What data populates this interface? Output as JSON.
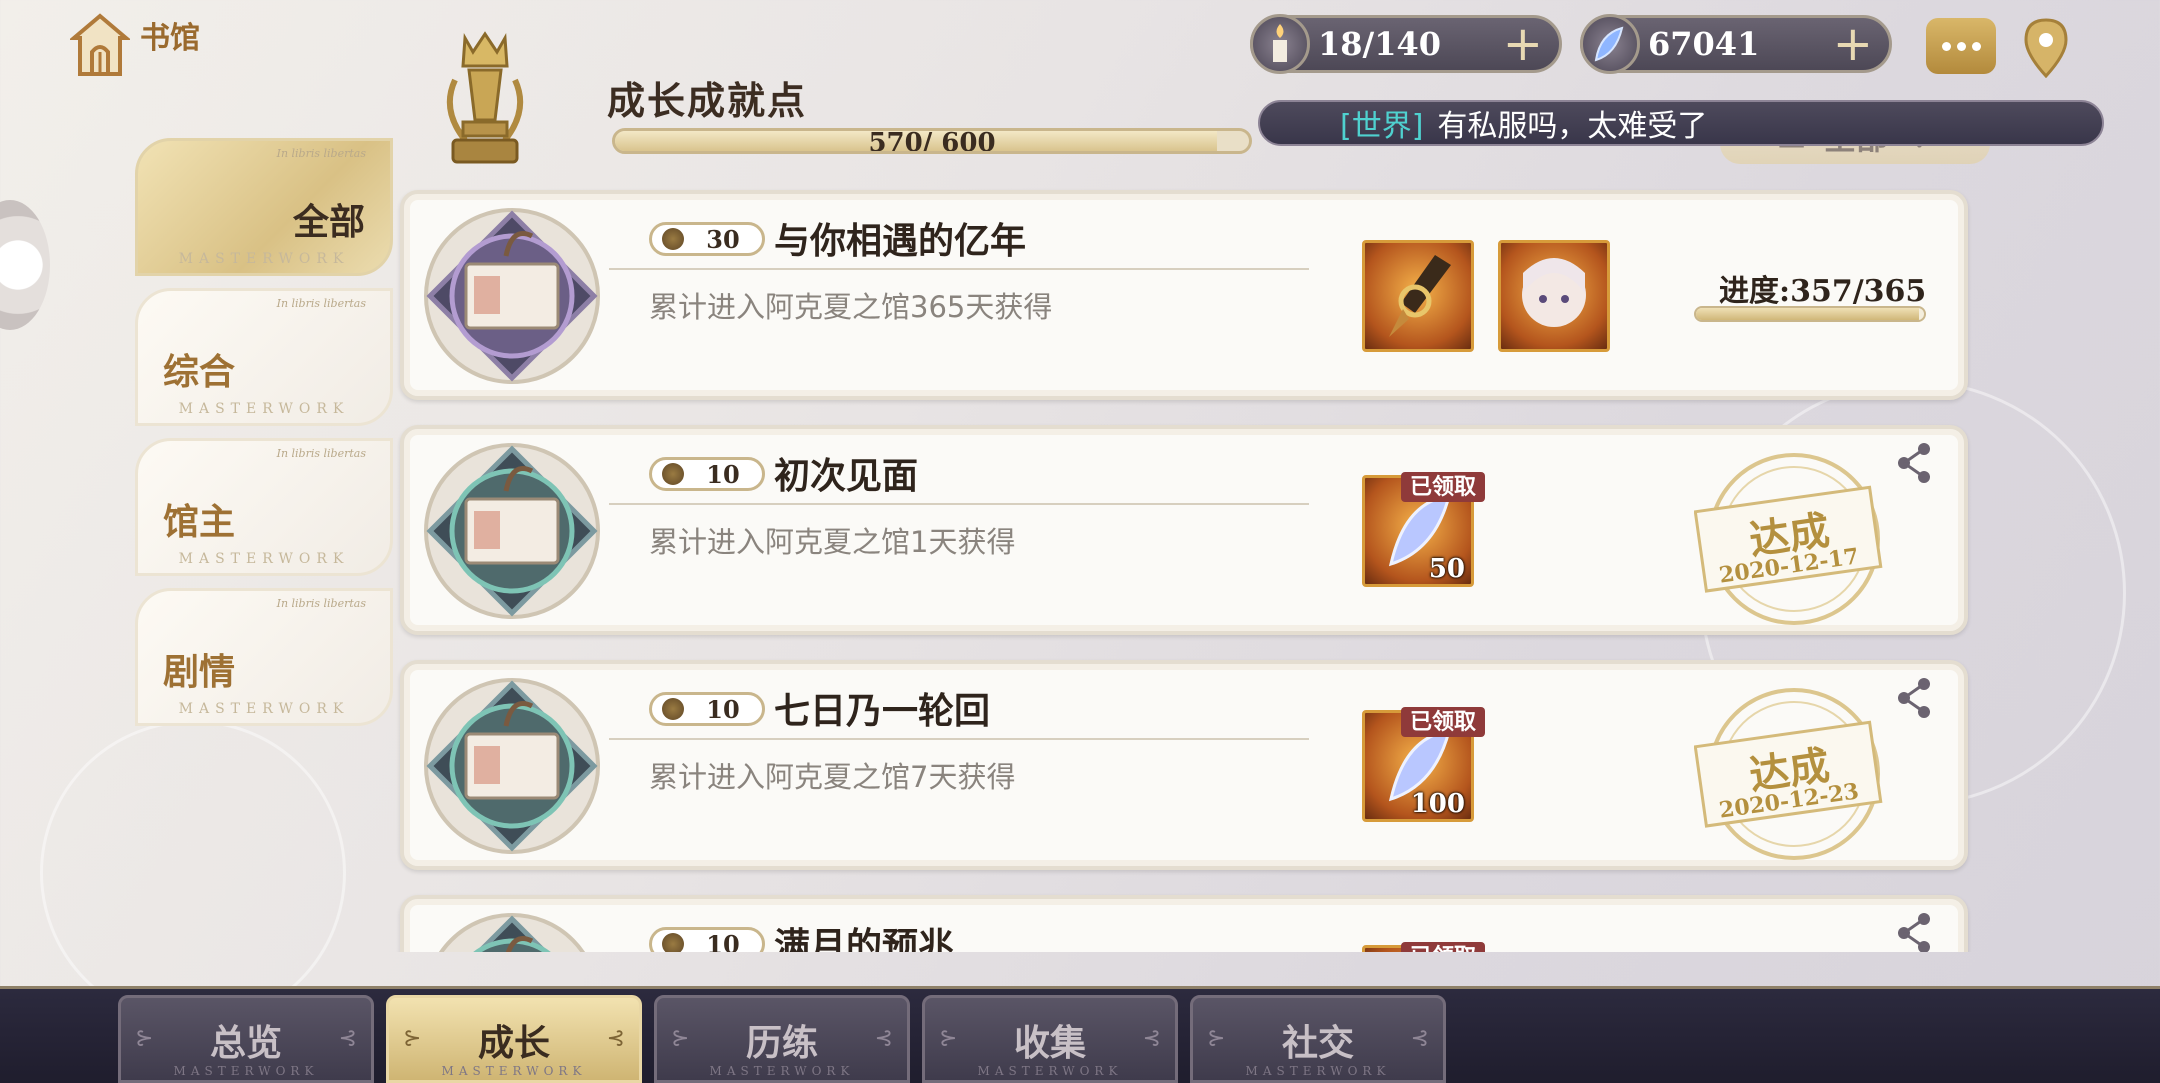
{
  "home": {
    "label": "书馆"
  },
  "header": {
    "title": "成长成就点",
    "progress_text": "570/ 600",
    "progress_fraction": 0.95
  },
  "currencies": [
    {
      "icon": "candle-icon",
      "value": "18/140"
    },
    {
      "icon": "feather-crystal-icon",
      "value": "67041"
    }
  ],
  "world_chat": {
    "channel": "[世界]",
    "message": "有私服吗，太难受了",
    "filter_label": "全部"
  },
  "side_tabs": [
    {
      "label": "全部",
      "top_text": "In libris libertas",
      "bottom_text": "MASTERWORK",
      "active": true
    },
    {
      "label": "综合",
      "top_text": "In libris libertas",
      "bottom_text": "MASTERWORK",
      "active": false
    },
    {
      "label": "馆主",
      "top_text": "In libris libertas",
      "bottom_text": "MASTERWORK",
      "active": false
    },
    {
      "label": "剧情",
      "top_text": "In libris libertas",
      "bottom_text": "MASTERWORK",
      "active": false
    }
  ],
  "achievements": [
    {
      "points": "30",
      "title": "与你相遇的亿年",
      "desc": "累计进入阿克夏之馆365天获得",
      "progress_label": "进度:357/365",
      "progress_fraction": 0.978
    },
    {
      "points": "10",
      "title": "初次见面",
      "desc": "累计进入阿克夏之馆1天获得",
      "claimed_label": "已领取",
      "reward_count": "50",
      "stamp_word": "达成",
      "stamp_date": "2020-12-17"
    },
    {
      "points": "10",
      "title": "七日乃一轮回",
      "desc": "累计进入阿克夏之馆7天获得",
      "claimed_label": "已领取",
      "reward_count": "100",
      "stamp_word": "达成",
      "stamp_date": "2020-12-23"
    },
    {
      "points": "10",
      "title": "满月的预兆",
      "claimed_label": "已领取"
    }
  ],
  "bottom_nav": [
    {
      "label": "总览",
      "sub": "MASTERWORK",
      "active": false
    },
    {
      "label": "成长",
      "sub": "MASTERWORK",
      "active": true
    },
    {
      "label": "历练",
      "sub": "MASTERWORK",
      "active": false
    },
    {
      "label": "收集",
      "sub": "MASTERWORK",
      "active": false
    },
    {
      "label": "社交",
      "sub": "MASTERWORK",
      "active": false
    }
  ],
  "colors": {
    "gold": "#d9c185",
    "dark_nav": "#2c2a3e",
    "chat_channel": "#4fd1cf",
    "claimed_red": "#8f3a3a"
  }
}
